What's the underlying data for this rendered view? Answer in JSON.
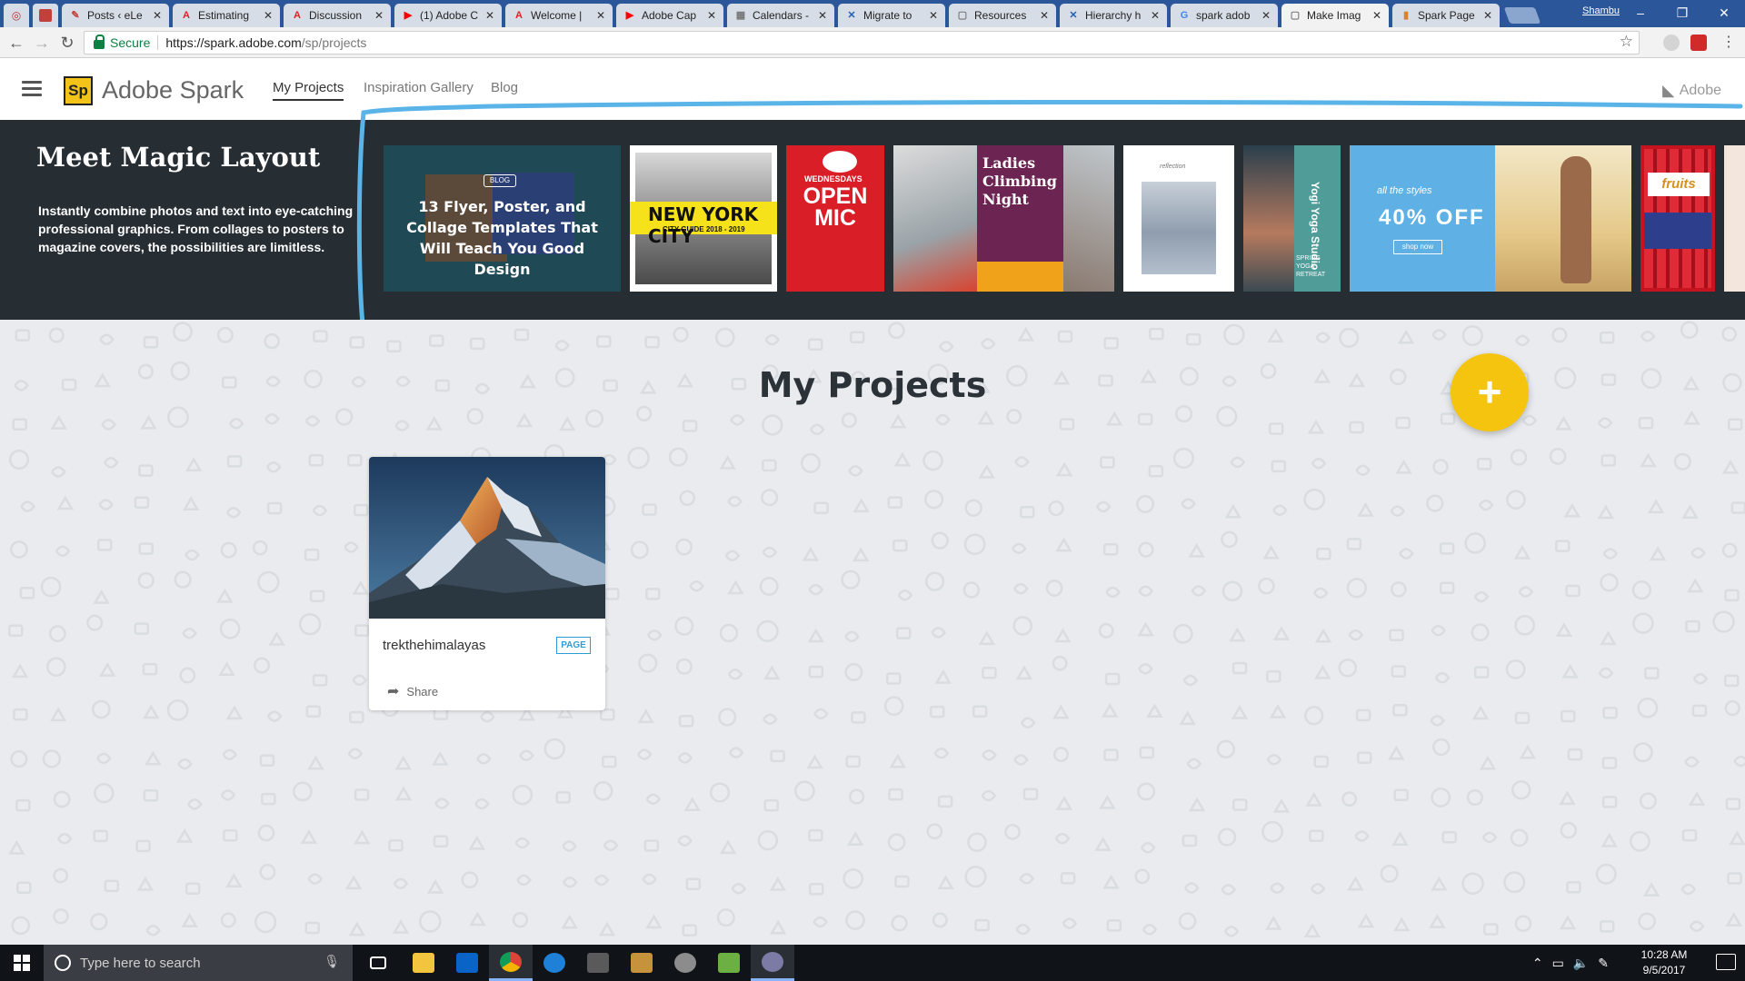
{
  "browser": {
    "tabs": [
      {
        "title": "Posts ‹ eLe",
        "icon_color": "#c1413a",
        "icon": "edit"
      },
      {
        "title": "Estimating",
        "icon_color": "#e31e25",
        "icon": "adobe"
      },
      {
        "title": "Discussion",
        "icon_color": "#e31e25",
        "icon": "adobe"
      },
      {
        "title": "(1) Adobe C",
        "icon_color": "#ff0000",
        "icon": "youtube"
      },
      {
        "title": "Welcome |",
        "icon_color": "#e31e25",
        "icon": "adobe"
      },
      {
        "title": "Adobe Cap",
        "icon_color": "#ff0000",
        "icon": "youtube"
      },
      {
        "title": "Calendars -",
        "icon_color": "#777777",
        "icon": "calendar"
      },
      {
        "title": "Migrate to",
        "icon_color": "#1f5fb8",
        "icon": "x"
      },
      {
        "title": "Resources",
        "icon_color": "#777777",
        "icon": "page"
      },
      {
        "title": "Hierarchy h",
        "icon_color": "#1f5fb8",
        "icon": "x"
      },
      {
        "title": "spark adob",
        "icon_color": "#4285f4",
        "icon": "google"
      },
      {
        "title": "Make Imag",
        "icon_color": "#777777",
        "icon": "page",
        "active": true
      },
      {
        "title": "Spark Page",
        "icon_color": "#d9822b",
        "icon": "book"
      }
    ],
    "user_name": "Shambu",
    "address": {
      "secure_label": "Secure",
      "url_host": "https://spark.adobe.com",
      "url_path": "/sp/projects"
    }
  },
  "header": {
    "logo_text": "Sp",
    "app_name": "Adobe Spark",
    "nav": [
      {
        "label": "My Projects",
        "active": true
      },
      {
        "label": "Inspiration Gallery"
      },
      {
        "label": "Blog"
      }
    ],
    "adobe_label": "Adobe"
  },
  "banner": {
    "title": "Meet Magic Layout",
    "description": "Instantly combine photos and text into eye-catching professional graphics. From collages to posters to magazine covers, the possibilities are limitless.",
    "thumbnails": {
      "blog_badge": "BLOG",
      "blog_text": "13 Flyer, Poster, and Collage Templates That Will Teach You Good Design",
      "nyc_title": "NEW YORK CITY",
      "nyc_sub": "CITY GUIDE 2018 - 2019",
      "mic_day": "WEDNESDAYS",
      "mic_title": "OPEN MIC",
      "climb_title": "Ladies Climbing Night",
      "refl_label": "reflection",
      "yoga_title": "Yogi Yoga Studio",
      "yoga_side": "SPRING YOGA RETREAT",
      "sale_top": "all the styles",
      "sale_main": "40% OFF",
      "sale_btn": "shop now",
      "fruit_label": "fruits"
    },
    "highlight_color": "#5bb4e8"
  },
  "main": {
    "title": "My Projects",
    "add_button": "+",
    "accent_color": "#f5c40e",
    "projects": [
      {
        "title": "trekthehimalayas",
        "type": "PAGE",
        "share_label": "Share"
      }
    ]
  },
  "taskbar": {
    "search_placeholder": "Type here to search",
    "time": "10:28 AM",
    "date": "9/5/2017"
  }
}
